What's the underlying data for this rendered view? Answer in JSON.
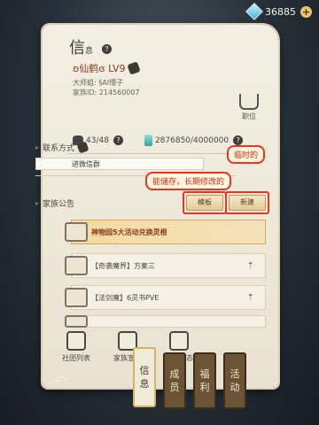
{
  "currency": {
    "amount": "36885",
    "plus": "+"
  },
  "panel": {
    "title": "信",
    "title_small": "息",
    "help": "?"
  },
  "profile": {
    "name": "ʚ仙鹤ɞ LV9",
    "master_label": "大师姐:",
    "master_value": "§AI懵子",
    "family_id_label": "家族ID:",
    "family_id_value": "214560007",
    "rank_label": "职位",
    "members": "43/48",
    "resources": "2876850/4000000"
  },
  "contact": {
    "label": "联系方式",
    "text": "进微信群"
  },
  "announcement": {
    "label": "家族公告",
    "template_button": "模板",
    "new_button": "新建"
  },
  "annotations": {
    "store_note": "能储存，长期修改的",
    "temp_note": "临时的"
  },
  "notices": [
    {
      "text": "神物园5大活动兑换灵根",
      "pinned": true
    },
    {
      "text": "【奇袭魔界】方案三",
      "pin_icon": "⇡"
    },
    {
      "text": "【法剑魔】6灵书PVE",
      "pin_icon": "⇡"
    },
    {
      "text": "",
      "pin_icon": ""
    }
  ],
  "bottom_buttons": {
    "list": "社团列表",
    "declaration": "家族宣言",
    "activity": "家族动态"
  },
  "tabs": [
    "信\n息",
    "成\n员",
    "福\n利",
    "活\n动"
  ],
  "icons": {
    "back": "back-arrow-icon",
    "gem": "gem-icon"
  }
}
